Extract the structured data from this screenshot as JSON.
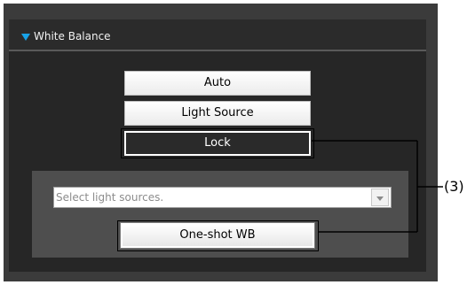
{
  "panel": {
    "section_title": "White Balance",
    "expand_icon": "triangle-down-icon",
    "accent_color": "#18a3e8"
  },
  "buttons": {
    "auto_label": "Auto",
    "light_source_label": "Light Source",
    "lock_label": "Lock"
  },
  "light_source_select": {
    "placeholder": "Select light sources.",
    "arrow_icon": "chevron-down-icon"
  },
  "oneshot": {
    "label": "One-shot WB"
  },
  "callout": {
    "label": "(3)"
  }
}
